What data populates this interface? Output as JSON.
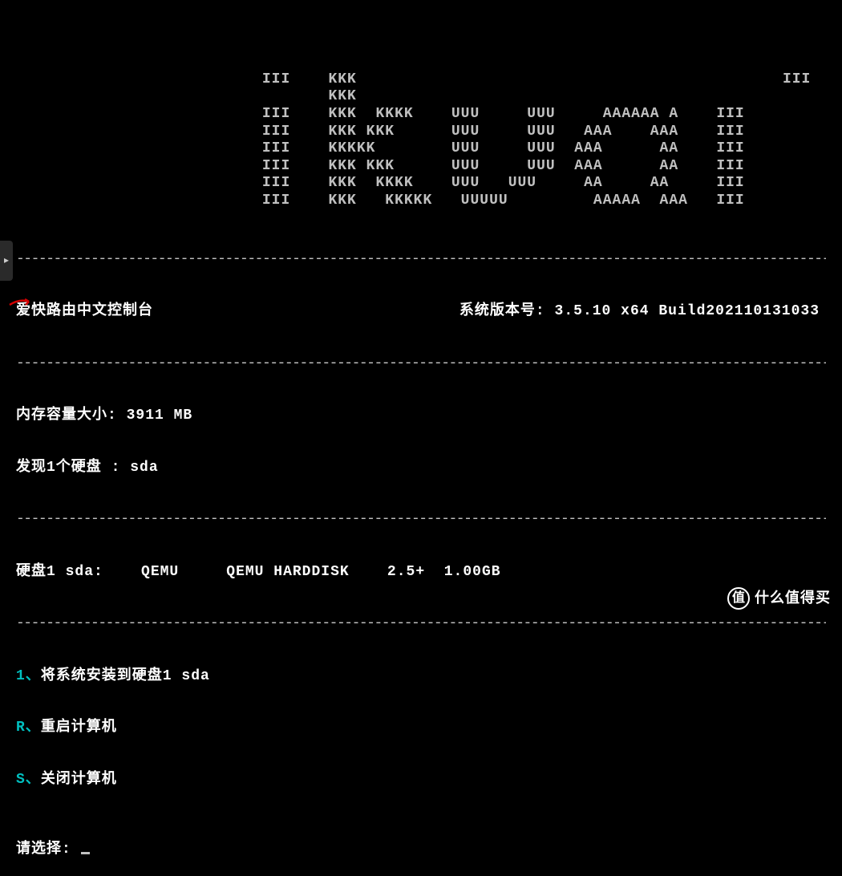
{
  "ascii_art": [
    "III    KKK                                             III",
    "       KKK",
    "III    KKK  KKKK    UUU     UUU     AAAAAA A    III",
    "III    KKK KKK      UUU     UUU   AAA    AAA    III",
    "III    KKKKK        UUU     UUU  AAA      AA    III",
    "III    KKK KKK      UUU     UUU  AAA      AA    III",
    "III    KKK  KKKK    UUU   UUU     AA     AA     III",
    "III    KKK   KKKKK   UUUUU         AAAAA  AAA   III"
  ],
  "header": {
    "console_title": "爱快路由中文控制台",
    "version_label": "系统版本号:",
    "version_value": "3.5.10 x64 Build202110131033"
  },
  "system_info": {
    "memory_label": "内存容量大小:",
    "memory_value": "3911 MB",
    "disk_found_label": "发现1个硬盘 :",
    "disk_found_value": "sda"
  },
  "disk_detail": {
    "label": "硬盘1 sda:",
    "vendor": "QEMU",
    "model": "QEMU HARDDISK",
    "version": "2.5+",
    "size": "1.00GB"
  },
  "menu": {
    "item1_key": "1、",
    "item1_label": "将系统安装到硬盘1 sda",
    "item2_key": "R、",
    "item2_label": "重启计算机",
    "item3_key": "S、",
    "item3_label": "关闭计算机"
  },
  "prompt": {
    "label": "请选择:"
  },
  "watermark": {
    "badge": "值",
    "text": "什么值得买"
  }
}
